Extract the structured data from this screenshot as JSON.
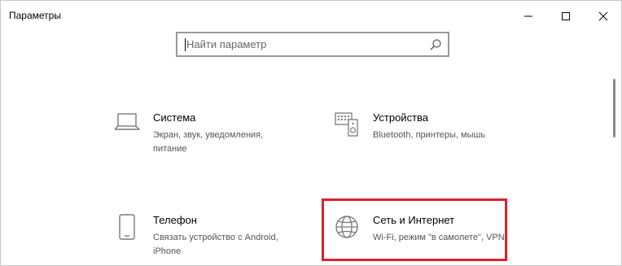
{
  "window": {
    "title": "Параметры"
  },
  "search": {
    "placeholder": "Найти параметр"
  },
  "tiles": [
    {
      "name": "Система",
      "description": "Экран, звук, уведомления, питание"
    },
    {
      "name": "Устройства",
      "description": "Bluetooth, принтеры, мышь"
    },
    {
      "name": "Телефон",
      "description": "Связать устройство с Android, iPhone"
    },
    {
      "name": "Сеть и Интернет",
      "description": "Wi-Fi, режим \"в самолете\", VPN"
    }
  ],
  "colors": {
    "highlight": "#e0202a",
    "icon": "#7a7a7a"
  },
  "icons": {
    "minimize": "minimize-icon",
    "maximize": "maximize-icon",
    "close": "close-icon",
    "search": "search-icon",
    "system": "laptop-icon",
    "devices": "keyboard-speaker-icon",
    "phone": "phone-icon",
    "network": "globe-icon"
  }
}
